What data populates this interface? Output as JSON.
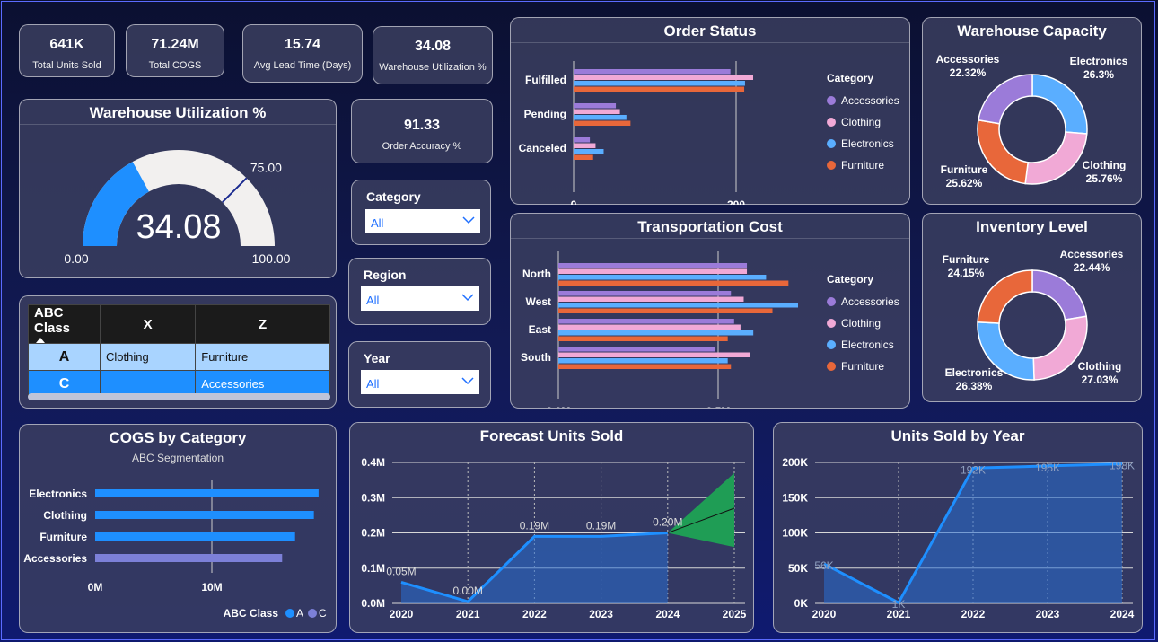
{
  "kpis": [
    {
      "value": "641K",
      "label": "Total Units Sold"
    },
    {
      "value": "71.24M",
      "label": "Total COGS"
    },
    {
      "value": "15.74",
      "label": "Avg Lead Time (Days)"
    },
    {
      "value": "34.08",
      "label": "Warehouse Utilization %"
    },
    {
      "value": "91.33",
      "label": "Order Accuracy %"
    }
  ],
  "gauge": {
    "title": "Warehouse Utilization %",
    "value_label": "34.08",
    "value": 34.08,
    "min_label": "0.00",
    "max_label": "100.00",
    "target_label": "75.00",
    "target": 75,
    "min": 0,
    "max": 100
  },
  "slicers": [
    {
      "label": "Category",
      "value": "All"
    },
    {
      "label": "Region",
      "value": "All"
    },
    {
      "label": "Year",
      "value": "All"
    }
  ],
  "abc_table": {
    "headers": [
      "ABC Class",
      "X",
      "Z"
    ],
    "rows": [
      {
        "class": "A",
        "x": "Clothing",
        "z": "Furniture"
      },
      {
        "class": "C",
        "x": "",
        "z": "Accessories"
      }
    ]
  },
  "colors": {
    "accessories": "#9b7bd9",
    "clothing": "#f1a9d6",
    "electronics": "#5aaeff",
    "furniture": "#e8673a",
    "primary_blue": "#1e8fff",
    "class_c": "#7c80d8",
    "forecast_green": "#1f9d55"
  },
  "legend": {
    "title": "Category",
    "items": [
      "Accessories",
      "Clothing",
      "Electronics",
      "Furniture"
    ]
  },
  "chart_data": [
    {
      "id": "order_status",
      "type": "bar",
      "orientation": "horizontal",
      "title": "Order Status",
      "categories": [
        "Fulfilled",
        "Pending",
        "Canceled"
      ],
      "series": [
        {
          "name": "Accessories",
          "values": [
            193,
            52,
            20
          ]
        },
        {
          "name": "Clothing",
          "values": [
            221,
            57,
            27
          ]
        },
        {
          "name": "Electronics",
          "values": [
            211,
            65,
            37
          ]
        },
        {
          "name": "Furniture",
          "values": [
            210,
            70,
            24
          ]
        }
      ],
      "xticks": [
        "0",
        "200"
      ],
      "xlim": [
        0,
        200
      ]
    },
    {
      "id": "warehouse_capacity",
      "type": "pie",
      "title": "Warehouse Capacity",
      "slices": [
        {
          "name": "Electronics",
          "value": 26.3,
          "label": "26.3%"
        },
        {
          "name": "Clothing",
          "value": 25.76,
          "label": "25.76%"
        },
        {
          "name": "Furniture",
          "value": 25.62,
          "label": "25.62%"
        },
        {
          "name": "Accessories",
          "value": 22.32,
          "label": "22.32%"
        }
      ]
    },
    {
      "id": "transportation_cost",
      "type": "bar",
      "orientation": "horizontal",
      "title": "Transportation Cost",
      "categories": [
        "North",
        "West",
        "East",
        "South"
      ],
      "series": [
        {
          "name": "Accessories",
          "values": [
            0.59,
            0.54,
            0.55,
            0.49
          ]
        },
        {
          "name": "Clothing",
          "values": [
            0.59,
            0.58,
            0.57,
            0.6
          ]
        },
        {
          "name": "Electronics",
          "values": [
            0.65,
            0.75,
            0.61,
            0.53
          ]
        },
        {
          "name": "Furniture",
          "values": [
            0.72,
            0.67,
            0.53,
            0.54
          ]
        }
      ],
      "xticks": [
        "0.0M",
        "0.5M"
      ],
      "xlim": [
        0,
        0.5
      ]
    },
    {
      "id": "inventory_level",
      "type": "pie",
      "title": "Inventory Level",
      "slices": [
        {
          "name": "Accessories",
          "value": 22.44,
          "label": "22.44%"
        },
        {
          "name": "Clothing",
          "value": 27.03,
          "label": "27.03%"
        },
        {
          "name": "Electronics",
          "value": 26.38,
          "label": "26.38%"
        },
        {
          "name": "Furniture",
          "value": 24.15,
          "label": "24.15%"
        }
      ]
    },
    {
      "id": "cogs_by_category",
      "type": "bar",
      "orientation": "horizontal",
      "title": "COGS by Category",
      "subtitle": "ABC Segmentation",
      "categories": [
        "Electronics",
        "Clothing",
        "Furniture",
        "Accessories"
      ],
      "values": [
        19.0,
        18.6,
        17.0,
        15.9
      ],
      "classes": [
        "A",
        "A",
        "A",
        "C"
      ],
      "xticks": [
        "0M",
        "10M"
      ],
      "xlim": [
        0,
        10
      ],
      "legend_title": "ABC Class",
      "legend_items": [
        "A",
        "C"
      ]
    },
    {
      "id": "forecast_units_sold",
      "type": "area",
      "title": "Forecast Units Sold",
      "x": [
        "2020",
        "2021",
        "2022",
        "2023",
        "2024"
      ],
      "values": [
        0.06,
        0.005,
        0.19,
        0.19,
        0.2
      ],
      "data_labels": [
        "0.05M",
        "0.00M",
        "0.19M",
        "0.19M",
        "0.20M"
      ],
      "forecast": {
        "x": [
          "2024",
          "2025"
        ],
        "mid": [
          0.2,
          0.27
        ],
        "upper": [
          0.2,
          0.37
        ],
        "lower": [
          0.2,
          0.16
        ]
      },
      "xticks": [
        "2020",
        "2021",
        "2022",
        "2023",
        "2024",
        "2025"
      ],
      "yticks": [
        "0.0M",
        "0.1M",
        "0.2M",
        "0.3M",
        "0.4M"
      ],
      "ylim": [
        0,
        0.4
      ]
    },
    {
      "id": "units_sold_by_year",
      "type": "area",
      "title": "Units Sold by Year",
      "x": [
        "2020",
        "2021",
        "2022",
        "2023",
        "2024"
      ],
      "values": [
        56,
        1,
        192,
        195,
        198
      ],
      "data_labels": [
        "56K",
        "1K",
        "192K",
        "195K",
        "198K"
      ],
      "xticks": [
        "2020",
        "2021",
        "2022",
        "2023",
        "2024"
      ],
      "yticks": [
        "0K",
        "50K",
        "100K",
        "150K",
        "200K"
      ],
      "ylim": [
        0,
        200
      ]
    }
  ]
}
